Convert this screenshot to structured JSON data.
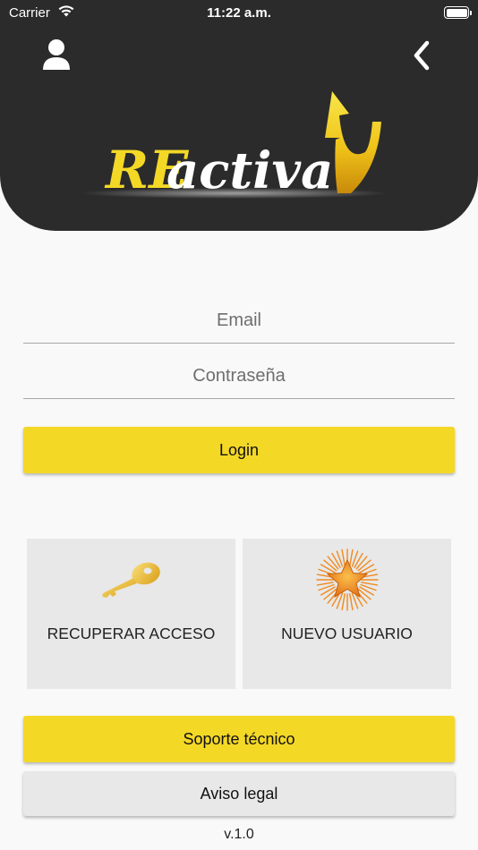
{
  "status_bar": {
    "carrier": "Carrier",
    "time": "11:22 a.m."
  },
  "logo": {
    "part1": "RE",
    "part2": "activa"
  },
  "form": {
    "email_placeholder": "Email",
    "password_placeholder": "Contraseña",
    "login_label": "Login"
  },
  "tiles": {
    "recover_label": "RECUPERAR ACCESO",
    "recover_icon": "key-icon",
    "new_user_label": "NUEVO USUARIO",
    "new_user_icon": "star-burst-icon"
  },
  "support_label": "Soporte técnico",
  "legal_label": "Aviso legal",
  "version": "v.1.0",
  "colors": {
    "header": "#2b2b2b",
    "accent": "#f4d826",
    "tile": "#e8e8e8",
    "background": "#f9f9f9"
  }
}
